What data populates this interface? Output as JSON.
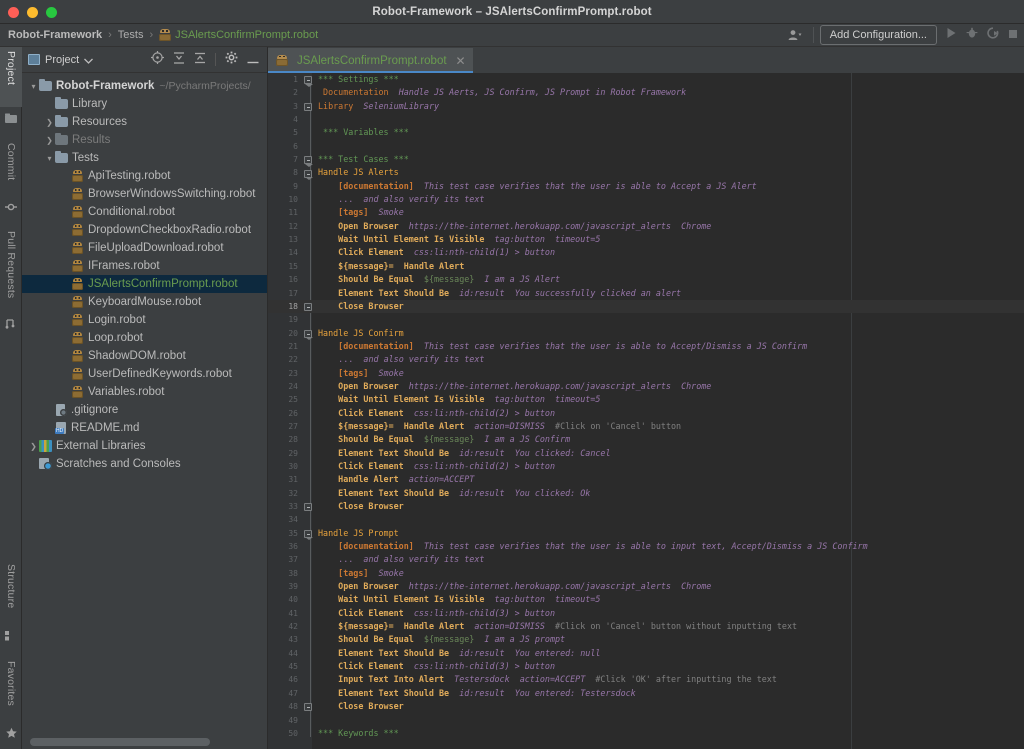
{
  "window": {
    "title": "Robot-Framework – JSAlertsConfirmPrompt.robot",
    "controls": [
      "close",
      "minimize",
      "zoom"
    ]
  },
  "navbar": {
    "breadcrumb": [
      {
        "label": "Robot-Framework",
        "type": "project"
      },
      {
        "label": "Tests",
        "type": "folder"
      },
      {
        "label": "JSAlertsConfirmPrompt.robot",
        "type": "file"
      }
    ],
    "separator": "›",
    "profile_icon": "user-dropdown-icon",
    "add_configuration_label": "Add Configuration...",
    "run_icon": "run-icon",
    "debug_icon": "debug-icon",
    "coverage_icon": "run-with-coverage-icon",
    "stop_icon": "stop-icon"
  },
  "left_strip": {
    "top_tabs": [
      {
        "label": "Project",
        "icon": "project-icon",
        "active": true
      },
      {
        "label": "Commit",
        "icon": "commit-icon",
        "active": false
      },
      {
        "label": "Pull Requests",
        "icon": "pull-requests-icon",
        "active": false
      }
    ],
    "bottom_tabs": [
      {
        "label": "Structure",
        "icon": "structure-icon",
        "active": false
      },
      {
        "label": "Favorites",
        "icon": "favorites-star-icon",
        "active": false
      }
    ]
  },
  "project_panel": {
    "header_label": "Project",
    "header_dropdown_icon": "chevron-down-icon",
    "toolbar_icons": [
      "scroll-from-source-icon",
      "expand-all-icon",
      "collapse-all-icon",
      "settings-gear-icon",
      "hide-icon"
    ],
    "tree": [
      {
        "indent": 0,
        "arrow": "down",
        "icon": "folder-icon",
        "label": "Robot-Framework",
        "path": "~/PycharmProjects/",
        "style": "bold"
      },
      {
        "indent": 1,
        "arrow": "none",
        "icon": "folder-icon",
        "label": "Library",
        "style": "normal"
      },
      {
        "indent": 1,
        "arrow": "right",
        "icon": "folder-icon",
        "label": "Resources",
        "style": "normal"
      },
      {
        "indent": 1,
        "arrow": "right",
        "icon": "folder-icon-dim",
        "label": "Results",
        "style": "dim"
      },
      {
        "indent": 1,
        "arrow": "down",
        "icon": "folder-icon",
        "label": "Tests",
        "style": "normal"
      },
      {
        "indent": 2,
        "arrow": "none",
        "icon": "robot-file-icon",
        "label": "ApiTesting.robot",
        "style": "normal"
      },
      {
        "indent": 2,
        "arrow": "none",
        "icon": "robot-file-icon",
        "label": "BrowserWindowsSwitching.robot",
        "style": "normal"
      },
      {
        "indent": 2,
        "arrow": "none",
        "icon": "robot-file-icon",
        "label": "Conditional.robot",
        "style": "normal"
      },
      {
        "indent": 2,
        "arrow": "none",
        "icon": "robot-file-icon",
        "label": "DropdownCheckboxRadio.robot",
        "style": "normal"
      },
      {
        "indent": 2,
        "arrow": "none",
        "icon": "robot-file-icon",
        "label": "FileUploadDownload.robot",
        "style": "normal"
      },
      {
        "indent": 2,
        "arrow": "none",
        "icon": "robot-file-icon",
        "label": "IFrames.robot",
        "style": "normal"
      },
      {
        "indent": 2,
        "arrow": "none",
        "icon": "robot-file-icon",
        "label": "JSAlertsConfirmPrompt.robot",
        "style": "green",
        "selected": true
      },
      {
        "indent": 2,
        "arrow": "none",
        "icon": "robot-file-icon",
        "label": "KeyboardMouse.robot",
        "style": "normal"
      },
      {
        "indent": 2,
        "arrow": "none",
        "icon": "robot-file-icon",
        "label": "Login.robot",
        "style": "normal"
      },
      {
        "indent": 2,
        "arrow": "none",
        "icon": "robot-file-icon",
        "label": "Loop.robot",
        "style": "normal"
      },
      {
        "indent": 2,
        "arrow": "none",
        "icon": "robot-file-icon",
        "label": "ShadowDOM.robot",
        "style": "normal"
      },
      {
        "indent": 2,
        "arrow": "none",
        "icon": "robot-file-icon",
        "label": "UserDefinedKeywords.robot",
        "style": "normal"
      },
      {
        "indent": 2,
        "arrow": "none",
        "icon": "robot-file-icon",
        "label": "Variables.robot",
        "style": "normal"
      },
      {
        "indent": 1,
        "arrow": "none",
        "icon": "gitignore-icon",
        "label": ".gitignore",
        "style": "normal"
      },
      {
        "indent": 1,
        "arrow": "none",
        "icon": "markdown-icon",
        "label": "README.md",
        "style": "normal"
      },
      {
        "indent": 0,
        "arrow": "right",
        "icon": "external-libraries-icon",
        "label": "External Libraries",
        "style": "normal"
      },
      {
        "indent": 0,
        "arrow": "none",
        "icon": "scratches-icon",
        "label": "Scratches and Consoles",
        "style": "normal"
      }
    ]
  },
  "editor": {
    "tab": {
      "label": "JSAlertsConfirmPrompt.robot",
      "icon": "robot-file-icon",
      "close_icon": "close-icon",
      "active": true
    },
    "current_line": 18,
    "first_line": 1,
    "last_line": 50,
    "lines": [
      {
        "n": 1,
        "fold": "open",
        "tokens": [
          {
            "t": "*** Settings ***",
            "c": "s-head"
          }
        ]
      },
      {
        "n": 2,
        "tokens": [
          {
            "t": "Documentation",
            "c": "s-set",
            "indent": 1
          },
          {
            "t": "Handle JS Aerts, JS Confirm, JS Prompt in Robot Framework",
            "c": "s-arg"
          }
        ]
      },
      {
        "n": 3,
        "fold": "close",
        "tokens": [
          {
            "t": "Library",
            "c": "s-set"
          },
          {
            "t": "SeleniumLibrary",
            "c": "s-arg"
          }
        ]
      },
      {
        "n": 4,
        "tokens": []
      },
      {
        "n": 5,
        "tokens": [
          {
            "t": "*** Variables ***",
            "c": "s-head",
            "indent": 1
          }
        ]
      },
      {
        "n": 6,
        "tokens": []
      },
      {
        "n": 7,
        "fold": "open",
        "tokens": [
          {
            "t": "*** Test Cases ***",
            "c": "s-head"
          }
        ]
      },
      {
        "n": 8,
        "fold": "open",
        "tokens": [
          {
            "t": "Handle JS Alerts",
            "c": "s-case"
          }
        ]
      },
      {
        "n": 9,
        "tokens": [
          {
            "t": "[documentation]",
            "c": "s-setb",
            "indent": 4
          },
          {
            "t": "This test case verifies that the user is able to Accept a JS Alert",
            "c": "s-arg"
          }
        ]
      },
      {
        "n": 10,
        "tokens": [
          {
            "t": "...",
            "c": "s-cont",
            "indent": 4
          },
          {
            "t": "and also verify its text",
            "c": "s-arg"
          }
        ]
      },
      {
        "n": 11,
        "tokens": [
          {
            "t": "[tags]",
            "c": "s-setb",
            "indent": 4
          },
          {
            "t": "Smoke",
            "c": "s-arg"
          }
        ]
      },
      {
        "n": 12,
        "tokens": [
          {
            "t": "Open Browser",
            "c": "s-kw",
            "indent": 4
          },
          {
            "t": "https://the-internet.herokuapp.com/javascript_alerts",
            "c": "s-arg"
          },
          {
            "t": "Chrome",
            "c": "s-arg"
          }
        ]
      },
      {
        "n": 13,
        "tokens": [
          {
            "t": "Wait Until Element Is Visible",
            "c": "s-kw",
            "indent": 4
          },
          {
            "t": "tag:button",
            "c": "s-arg"
          },
          {
            "t": "timeout=5",
            "c": "s-arg"
          }
        ]
      },
      {
        "n": 14,
        "tokens": [
          {
            "t": "Click Element",
            "c": "s-kw",
            "indent": 4
          },
          {
            "t": "css:li:nth-child(1) > button",
            "c": "s-arg"
          }
        ]
      },
      {
        "n": 15,
        "tokens": [
          {
            "t": "${message}=",
            "c": "s-kw",
            "indent": 4
          },
          {
            "t": "Handle Alert",
            "c": "s-kw"
          }
        ]
      },
      {
        "n": 16,
        "tokens": [
          {
            "t": "Should Be Equal",
            "c": "s-kw",
            "indent": 4
          },
          {
            "t": "${message}",
            "c": "s-var"
          },
          {
            "t": "I am a JS Alert",
            "c": "s-arg"
          }
        ]
      },
      {
        "n": 17,
        "tokens": [
          {
            "t": "Element Text Should Be",
            "c": "s-kw",
            "indent": 4
          },
          {
            "t": "id:result",
            "c": "s-arg"
          },
          {
            "t": "You successfully clicked an alert",
            "c": "s-arg"
          }
        ]
      },
      {
        "n": 18,
        "fold": "close",
        "current": true,
        "tokens": [
          {
            "t": "Close Browser",
            "c": "s-kw",
            "indent": 4
          }
        ]
      },
      {
        "n": 19,
        "tokens": []
      },
      {
        "n": 20,
        "fold": "open",
        "tokens": [
          {
            "t": "Handle JS Confirm",
            "c": "s-case"
          }
        ]
      },
      {
        "n": 21,
        "tokens": [
          {
            "t": "[documentation]",
            "c": "s-setb",
            "indent": 4
          },
          {
            "t": "This test case verifies that the user is able to Accept/Dismiss a JS Confirm",
            "c": "s-arg"
          }
        ]
      },
      {
        "n": 22,
        "tokens": [
          {
            "t": "...",
            "c": "s-cont",
            "indent": 4
          },
          {
            "t": "and also verify its text",
            "c": "s-arg"
          }
        ]
      },
      {
        "n": 23,
        "tokens": [
          {
            "t": "[tags]",
            "c": "s-setb",
            "indent": 4
          },
          {
            "t": "Smoke",
            "c": "s-arg"
          }
        ]
      },
      {
        "n": 24,
        "tokens": [
          {
            "t": "Open Browser",
            "c": "s-kw",
            "indent": 4
          },
          {
            "t": "https://the-internet.herokuapp.com/javascript_alerts",
            "c": "s-arg"
          },
          {
            "t": "Chrome",
            "c": "s-arg"
          }
        ]
      },
      {
        "n": 25,
        "tokens": [
          {
            "t": "Wait Until Element Is Visible",
            "c": "s-kw",
            "indent": 4
          },
          {
            "t": "tag:button",
            "c": "s-arg"
          },
          {
            "t": "timeout=5",
            "c": "s-arg"
          }
        ]
      },
      {
        "n": 26,
        "tokens": [
          {
            "t": "Click Element",
            "c": "s-kw",
            "indent": 4
          },
          {
            "t": "css:li:nth-child(2) > button",
            "c": "s-arg"
          }
        ]
      },
      {
        "n": 27,
        "tokens": [
          {
            "t": "${message}=",
            "c": "s-kw",
            "indent": 4
          },
          {
            "t": "Handle Alert",
            "c": "s-kw"
          },
          {
            "t": "action=DISMISS",
            "c": "s-arg"
          },
          {
            "t": "#Click on 'Cancel' button",
            "c": "s-com"
          }
        ]
      },
      {
        "n": 28,
        "tokens": [
          {
            "t": "Should Be Equal",
            "c": "s-kw",
            "indent": 4
          },
          {
            "t": "${message}",
            "c": "s-var"
          },
          {
            "t": "I am a JS Confirm",
            "c": "s-arg"
          }
        ]
      },
      {
        "n": 29,
        "tokens": [
          {
            "t": "Element Text Should Be",
            "c": "s-kw",
            "indent": 4
          },
          {
            "t": "id:result",
            "c": "s-arg"
          },
          {
            "t": "You clicked: Cancel",
            "c": "s-arg"
          }
        ]
      },
      {
        "n": 30,
        "tokens": [
          {
            "t": "Click Element",
            "c": "s-kw",
            "indent": 4
          },
          {
            "t": "css:li:nth-child(2) > button",
            "c": "s-arg"
          }
        ]
      },
      {
        "n": 31,
        "tokens": [
          {
            "t": "Handle Alert",
            "c": "s-kw",
            "indent": 4
          },
          {
            "t": "action=ACCEPT",
            "c": "s-arg"
          }
        ]
      },
      {
        "n": 32,
        "tokens": [
          {
            "t": "Element Text Should Be",
            "c": "s-kw",
            "indent": 4
          },
          {
            "t": "id:result",
            "c": "s-arg"
          },
          {
            "t": "You clicked: Ok",
            "c": "s-arg"
          }
        ]
      },
      {
        "n": 33,
        "fold": "close",
        "tokens": [
          {
            "t": "Close Browser",
            "c": "s-kw",
            "indent": 4
          }
        ]
      },
      {
        "n": 34,
        "tokens": []
      },
      {
        "n": 35,
        "fold": "open",
        "tokens": [
          {
            "t": "Handle JS Prompt",
            "c": "s-case"
          }
        ]
      },
      {
        "n": 36,
        "tokens": [
          {
            "t": "[documentation]",
            "c": "s-setb",
            "indent": 4
          },
          {
            "t": "This test case verifies that the user is able to input text, Accept/Dismiss a JS Confirm",
            "c": "s-arg"
          }
        ]
      },
      {
        "n": 37,
        "tokens": [
          {
            "t": "...",
            "c": "s-cont",
            "indent": 4
          },
          {
            "t": "and also verify its text",
            "c": "s-arg"
          }
        ]
      },
      {
        "n": 38,
        "tokens": [
          {
            "t": "[tags]",
            "c": "s-setb",
            "indent": 4
          },
          {
            "t": "Smoke",
            "c": "s-arg"
          }
        ]
      },
      {
        "n": 39,
        "tokens": [
          {
            "t": "Open Browser",
            "c": "s-kw",
            "indent": 4
          },
          {
            "t": "https://the-internet.herokuapp.com/javascript_alerts",
            "c": "s-arg"
          },
          {
            "t": "Chrome",
            "c": "s-arg"
          }
        ]
      },
      {
        "n": 40,
        "tokens": [
          {
            "t": "Wait Until Element Is Visible",
            "c": "s-kw",
            "indent": 4
          },
          {
            "t": "tag:button",
            "c": "s-arg"
          },
          {
            "t": "timeout=5",
            "c": "s-arg"
          }
        ]
      },
      {
        "n": 41,
        "tokens": [
          {
            "t": "Click Element",
            "c": "s-kw",
            "indent": 4
          },
          {
            "t": "css:li:nth-child(3) > button",
            "c": "s-arg"
          }
        ]
      },
      {
        "n": 42,
        "tokens": [
          {
            "t": "${message}=",
            "c": "s-kw",
            "indent": 4
          },
          {
            "t": "Handle Alert",
            "c": "s-kw"
          },
          {
            "t": "action=DISMISS",
            "c": "s-arg"
          },
          {
            "t": "#Click on 'Cancel' button without inputting text",
            "c": "s-com"
          }
        ]
      },
      {
        "n": 43,
        "tokens": [
          {
            "t": "Should Be Equal",
            "c": "s-kw",
            "indent": 4
          },
          {
            "t": "${message}",
            "c": "s-var"
          },
          {
            "t": "I am a JS prompt",
            "c": "s-arg"
          }
        ]
      },
      {
        "n": 44,
        "tokens": [
          {
            "t": "Element Text Should Be",
            "c": "s-kw",
            "indent": 4
          },
          {
            "t": "id:result",
            "c": "s-arg"
          },
          {
            "t": "You entered: null",
            "c": "s-arg"
          }
        ]
      },
      {
        "n": 45,
        "tokens": [
          {
            "t": "Click Element",
            "c": "s-kw",
            "indent": 4
          },
          {
            "t": "css:li:nth-child(3) > button",
            "c": "s-arg"
          }
        ]
      },
      {
        "n": 46,
        "tokens": [
          {
            "t": "Input Text Into Alert",
            "c": "s-kw",
            "indent": 4
          },
          {
            "t": "Testersdock",
            "c": "s-arg"
          },
          {
            "t": "action=ACCEPT",
            "c": "s-arg"
          },
          {
            "t": "#Click 'OK' after inputting the text",
            "c": "s-com"
          }
        ]
      },
      {
        "n": 47,
        "tokens": [
          {
            "t": "Element Text Should Be",
            "c": "s-kw",
            "indent": 4
          },
          {
            "t": "id:result",
            "c": "s-arg"
          },
          {
            "t": "You entered: Testersdock",
            "c": "s-arg"
          }
        ]
      },
      {
        "n": 48,
        "fold": "close",
        "tokens": [
          {
            "t": "Close Browser",
            "c": "s-kw",
            "indent": 4
          }
        ]
      },
      {
        "n": 49,
        "tokens": []
      },
      {
        "n": 50,
        "tokens": [
          {
            "t": "*** Keywords ***",
            "c": "s-head"
          }
        ]
      }
    ]
  },
  "colors": {
    "window_chrome": "#3c3f41",
    "editor_background": "#2b2b2b",
    "gutter_background": "#313335",
    "selection_blue": "#0d293e",
    "tab_underline": "#4a88c7",
    "accent_green": "#6a9c4f",
    "keyword_orange": "#e0ab5a",
    "argument_purple": "#9876aa",
    "section_green": "#629755",
    "comment_gray": "#808080"
  }
}
